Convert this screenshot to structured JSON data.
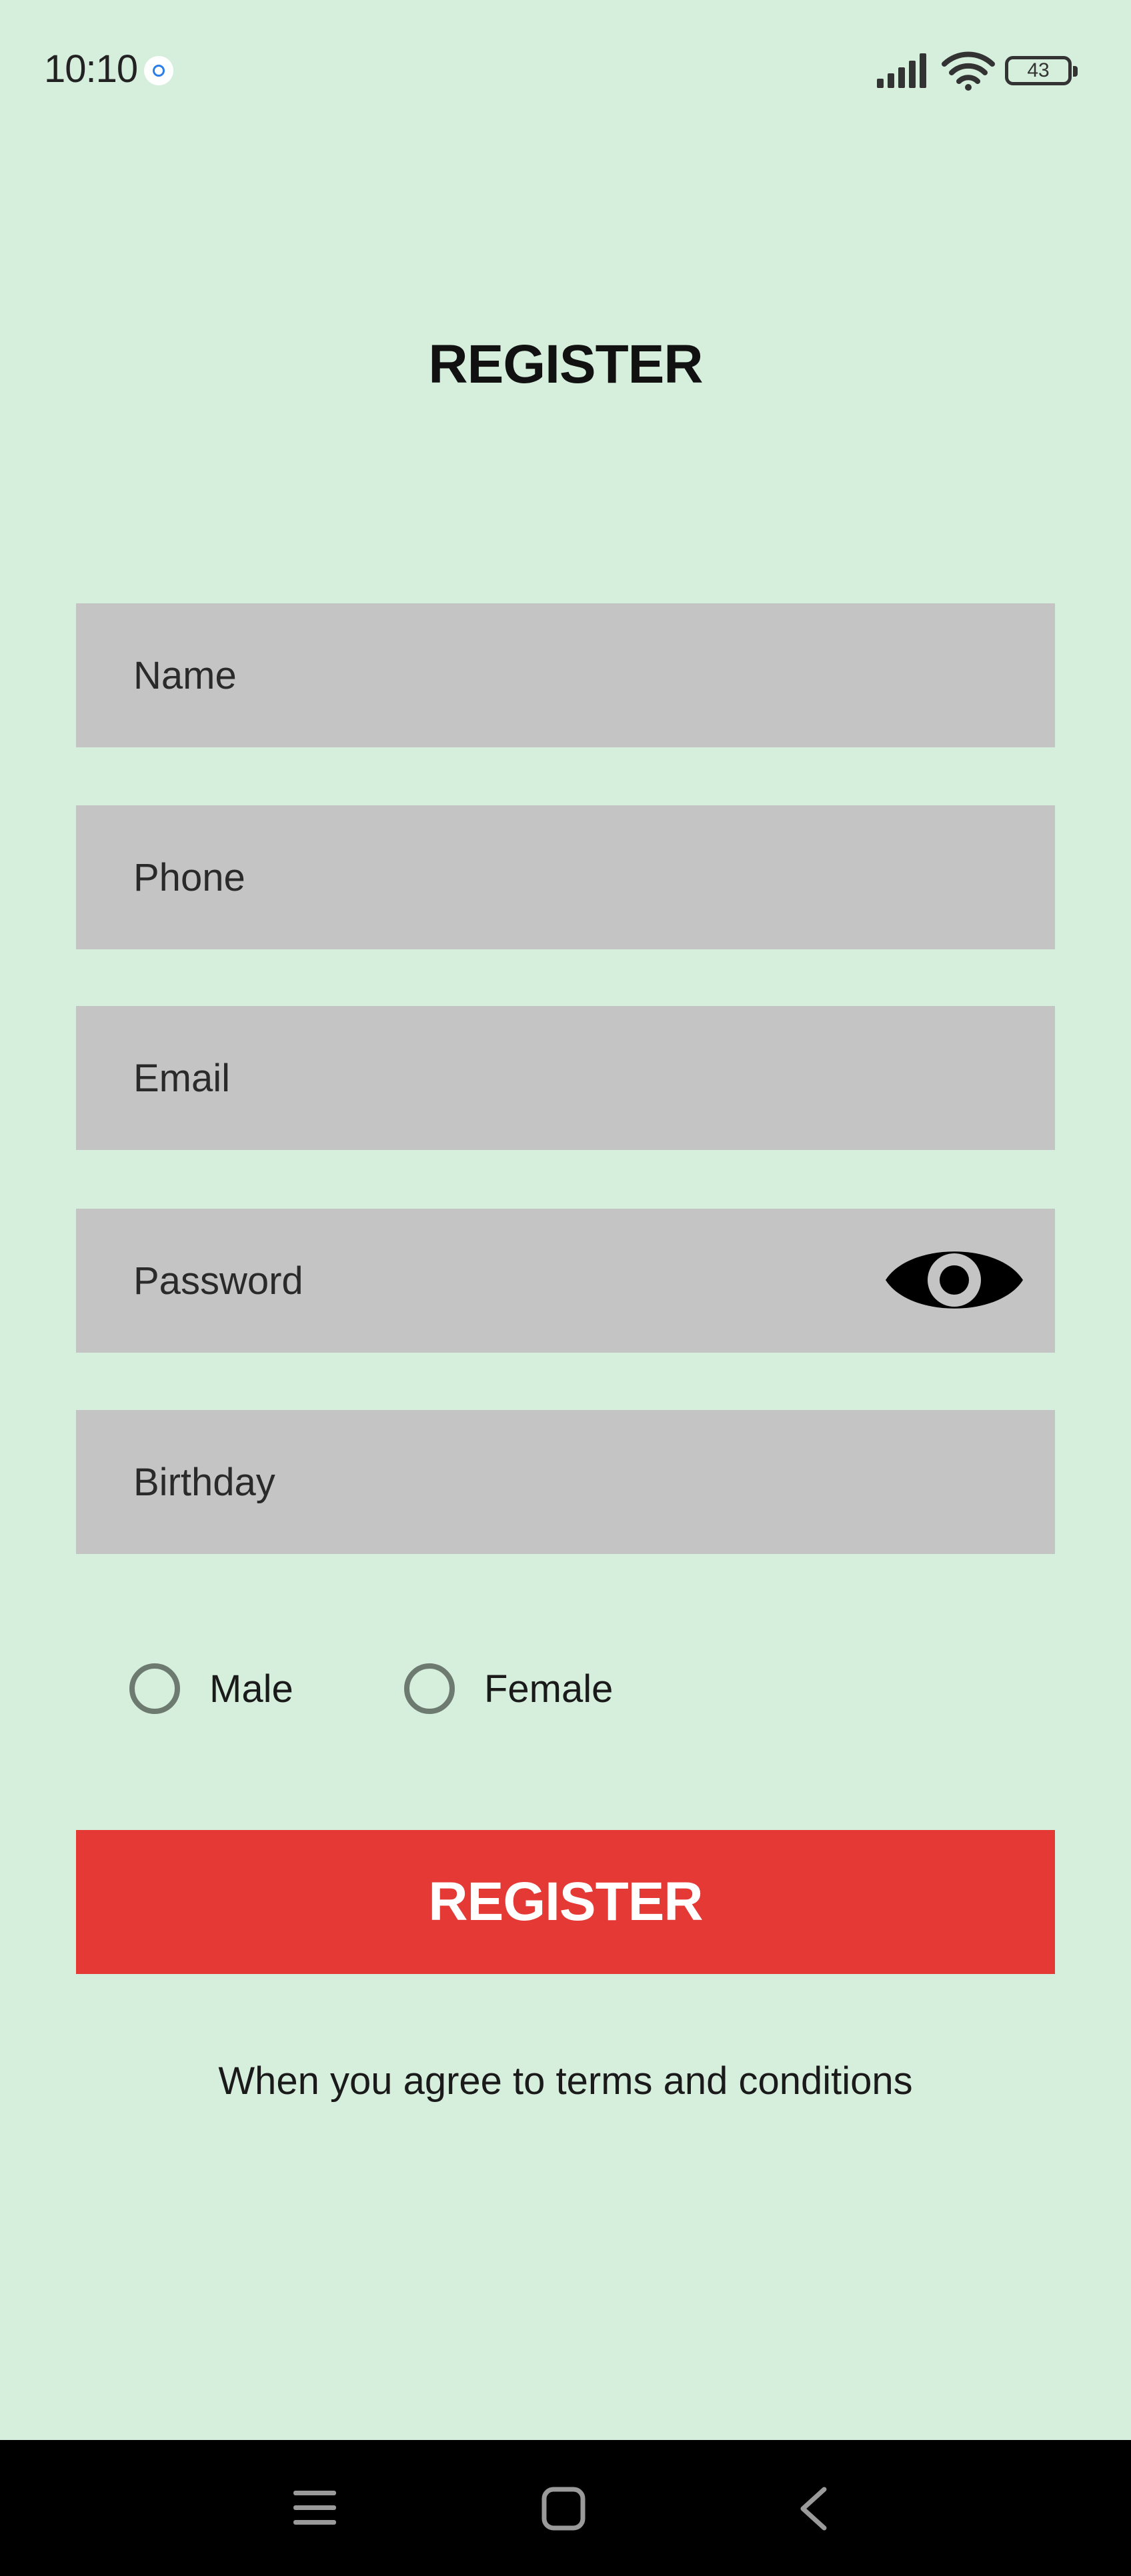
{
  "status_bar": {
    "time": "10:10",
    "battery_level": "43",
    "icons": [
      "notification-dot-icon",
      "signal-icon",
      "wifi-icon",
      "battery-icon"
    ]
  },
  "title": "REGISTER",
  "form": {
    "name_placeholder": "Name",
    "phone_placeholder": "Phone",
    "email_placeholder": "Email",
    "password_placeholder": "Password",
    "birthday_placeholder": "Birthday",
    "password_toggle_icon": "eye-icon",
    "gender": {
      "male_label": "Male",
      "female_label": "Female",
      "selected": null
    },
    "submit_label": "REGISTER",
    "terms_text": "When you agree to terms and conditions"
  },
  "nav_bar": {
    "icons": [
      "menu-icon",
      "home-icon",
      "back-icon"
    ]
  },
  "colors": {
    "background": "#d6eedc",
    "field": "#c4c4c4",
    "accent": "#e53935",
    "nav_bar": "#000000"
  }
}
